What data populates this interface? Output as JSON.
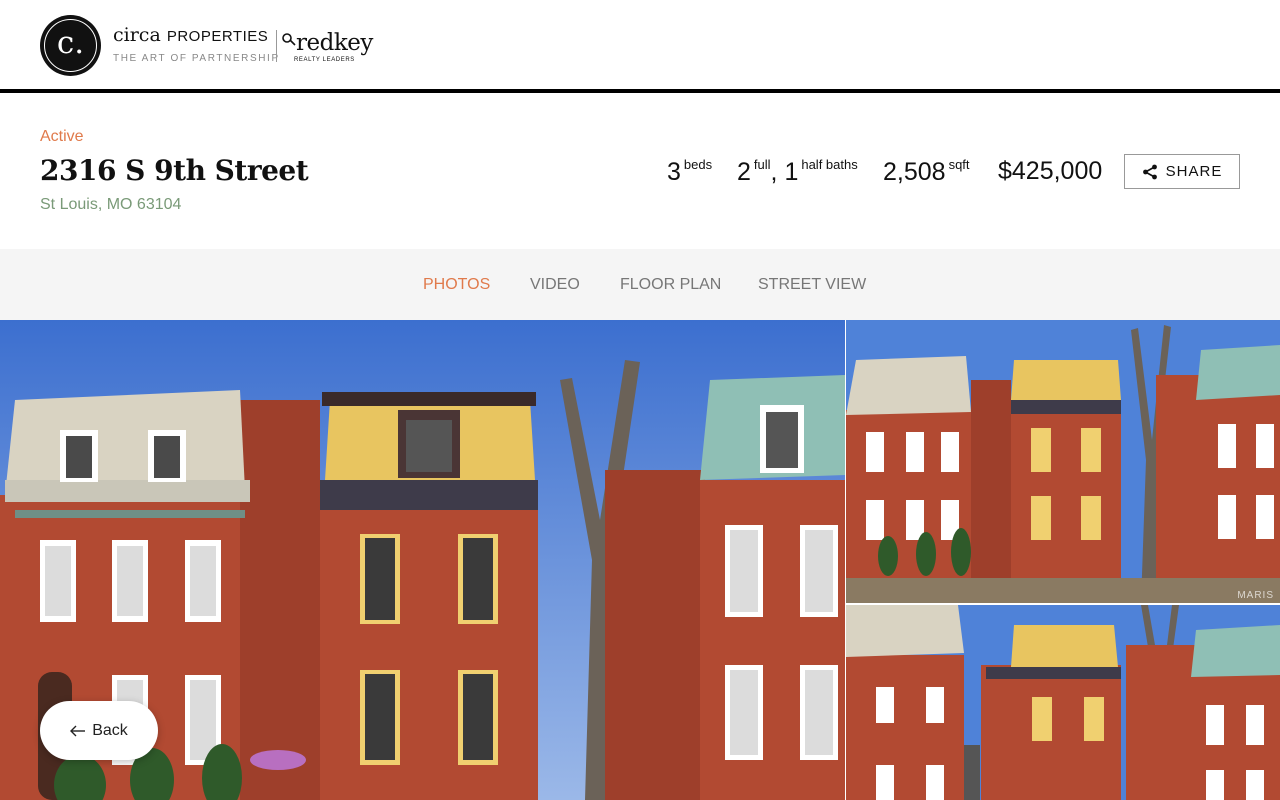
{
  "brand": {
    "logo_letter": "c.",
    "name": "circa",
    "name_sub": "PROPERTIES",
    "tagline": "THE ART OF PARTNERSHIP",
    "partner_name": "redkey",
    "partner_tagline": "REALTY LEADERS"
  },
  "listing": {
    "status": "Active",
    "address": "2316 S 9th Street",
    "city": "St Louis, MO 63104",
    "beds_value": "3",
    "beds_unit": "beds",
    "baths_full_value": "2",
    "baths_full_unit": "full",
    "baths_half_value": "1",
    "baths_half_unit": "half baths",
    "sqft_value": "2,508",
    "sqft_unit": "sqft",
    "price": "$425,000"
  },
  "actions": {
    "share_label": "SHARE",
    "back_label": "Back"
  },
  "tabs": [
    {
      "label": "PHOTOS",
      "active": true
    },
    {
      "label": "VIDEO",
      "active": false
    },
    {
      "label": "FLOOR PLAN",
      "active": false
    },
    {
      "label": "STREET VIEW",
      "active": false
    }
  ],
  "photos": {
    "watermark": "MARIS"
  },
  "colors": {
    "accent": "#e07a4b",
    "city_text": "#7a9a78",
    "sky": "#4a7bd4",
    "brick": "#b4452f",
    "mansard_yellow": "#e8c560",
    "mansard_teal": "#8fbfb5",
    "mansard_cream": "#d8d2c0"
  }
}
